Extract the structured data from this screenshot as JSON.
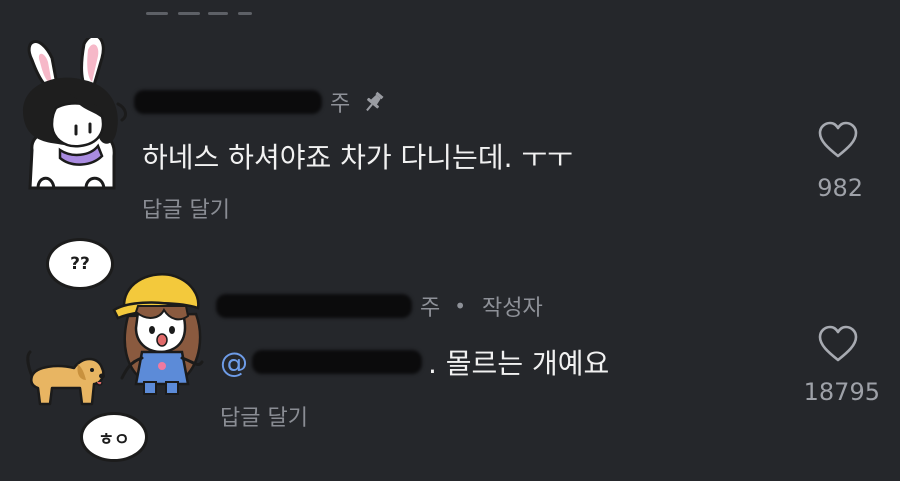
{
  "comments": [
    {
      "author_suffix": "주",
      "pinned": true,
      "text": "하네스 하셔야죠 차가 다니는데. ㅜㅜ",
      "reply_label": "답글 달기",
      "likes": "982"
    },
    {
      "author_suffix": "주",
      "author_badge": "작성자",
      "mention": "@",
      "text": ". 몰르는 개예요",
      "reply_label": "답글 달기",
      "likes": "18795"
    }
  ],
  "stickers": {
    "bubble_question": "??",
    "bubble_laugh": "ㅎㅇ"
  },
  "colors": {
    "background": "#25272b",
    "muted_text": "#8e9198",
    "mention": "#6e9ce8",
    "body_text": "#f1f1f1"
  },
  "icons": [
    "pin-icon",
    "heart-icon",
    "bunny-avatar-icon",
    "girl-avatar-icon",
    "dog-sticker-icon"
  ]
}
